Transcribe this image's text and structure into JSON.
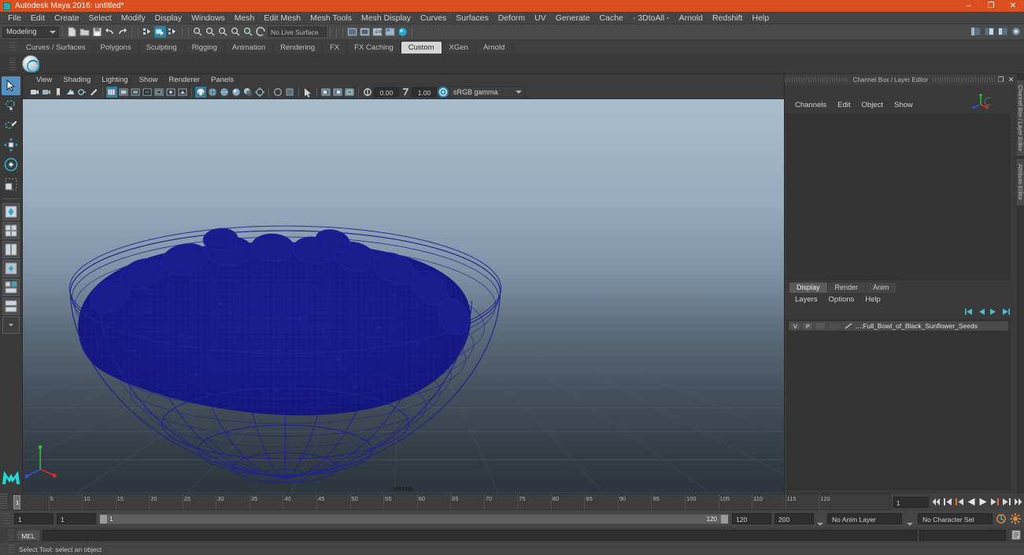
{
  "window": {
    "title": "Autodesk Maya 2016: untitled*",
    "app_icon": "maya-icon",
    "minimize": "–",
    "maximize": "❐",
    "close": "✕",
    "accent": "#d94f20"
  },
  "menubar": {
    "items": [
      "File",
      "Edit",
      "Create",
      "Select",
      "Modify",
      "Display",
      "Windows",
      "Mesh",
      "Edit Mesh",
      "Mesh Tools",
      "Mesh Display",
      "Curves",
      "Surfaces",
      "Deform",
      "UV",
      "Generate",
      "Cache",
      "- 3DtoAll -",
      "Arnold",
      "Redshift",
      "Help"
    ]
  },
  "statusline": {
    "menu_set": "Modeling",
    "live_surface": "No Live Surface",
    "icons": [
      "new-scene-icon",
      "open-scene-icon",
      "save-scene-icon",
      "undo-icon",
      "redo-icon",
      "select-by-hierarchy-icon",
      "select-by-object-icon",
      "select-by-component-icon",
      "snap-to-grid-icon",
      "snap-to-curve-icon",
      "snap-to-point-icon",
      "snap-to-projected-center-icon",
      "snap-to-view-plane-icon",
      "make-live-icon",
      "show-render-view-icon",
      "render-current-frame-icon",
      "ipr-render-icon",
      "render-settings-icon",
      "hypershade-icon"
    ],
    "right_icons": [
      "sidebar-toggle-icon",
      "channel-box-toggle-icon",
      "attribute-editor-toggle-icon",
      "tool-settings-toggle-icon"
    ]
  },
  "shelf": {
    "tabs": [
      "Curves / Surfaces",
      "Polygons",
      "Sculpting",
      "Rigging",
      "Animation",
      "Rendering",
      "FX",
      "FX Caching",
      "Custom",
      "XGen",
      "Arnold"
    ],
    "active_tab": "Custom",
    "buttons": [
      "custom-shelf-button"
    ]
  },
  "toolbox": {
    "tools": [
      {
        "name": "select-tool",
        "selected": true
      },
      {
        "name": "lasso-select-tool",
        "selected": false
      },
      {
        "name": "paint-select-tool",
        "selected": false
      },
      {
        "name": "move-tool",
        "selected": false
      },
      {
        "name": "rotate-tool",
        "selected": false
      },
      {
        "name": "scale-tool",
        "selected": false
      }
    ],
    "layouts": [
      "single-perspective-layout",
      "four-view-layout",
      "two-pane-side-layout",
      "outliner-persp-layout",
      "hypershade-persp-layout",
      "persp-graph-layout",
      "more-layouts"
    ],
    "logo": "maya-logo"
  },
  "viewport": {
    "panel_menu": [
      "View",
      "Shading",
      "Lighting",
      "Show",
      "Renderer",
      "Panels"
    ],
    "toolbar_icons": [
      "select-camera-icon",
      "camera-attributes-icon",
      "bookmark-icon",
      "image-plane-icon",
      "two-sided-lighting-icon",
      "grid-toggle-icon",
      "film-gate-icon",
      "resolution-gate-icon",
      "gate-mask-icon",
      "xray-icon",
      "xray-joints-icon",
      "xray-active-components-icon",
      "smooth-shade-all-icon",
      "wireframe-on-shaded-icon",
      "textured-icon",
      "use-all-lights-icon",
      "shadows-icon",
      "screen-space-ao-icon",
      "motion-blur-icon",
      "multisample-icon",
      "depth-of-field-icon",
      "isolate-select-icon",
      "grid-icon",
      "film-gate-2-icon",
      "exposure-icon",
      "gamma-icon",
      "color-management-icon"
    ],
    "exposure_value": "0.00",
    "gamma_value": "1.00",
    "view_transform": "sRGB gamma",
    "camera_label": "persp",
    "axis_gizmo": "axis-gizmo",
    "scene": {
      "object": "wireframe bowl filled with sunflower seeds",
      "wire_color": "#1b1f8f",
      "grid_color": "#5a6876"
    }
  },
  "channel_box": {
    "panel_title": "Channel Box / Layer Editor",
    "float_button": "❐",
    "close_button": "✕",
    "menu": [
      "Channels",
      "Edit",
      "Object",
      "Show"
    ],
    "axis_widget": "view-axis-widget"
  },
  "layer_editor": {
    "tabs": [
      "Display",
      "Render",
      "Anim"
    ],
    "active_tab": "Display",
    "menu": [
      "Layers",
      "Options",
      "Help"
    ],
    "toolbar_icons": [
      "layer-first-icon",
      "layer-prev-icon",
      "layer-next-icon",
      "layer-last-icon"
    ],
    "layers": [
      {
        "visible": "V",
        "playback": "P",
        "shading": "",
        "type_icon": "layer-line-icon",
        "name": "...:Full_Bowl_of_Black_Sunflower_Seeds"
      }
    ]
  },
  "vertical_tabs": [
    "Channel Box / Layer Editor",
    "Attribute Editor"
  ],
  "timeline": {
    "tick_labels": [
      "5",
      "10",
      "15",
      "20",
      "25",
      "30",
      "35",
      "40",
      "45",
      "50",
      "55",
      "60",
      "65",
      "70",
      "75",
      "80",
      "85",
      "90",
      "95",
      "100",
      "105",
      "110",
      "115",
      "120"
    ],
    "current_frame": "1",
    "current_frame_field": "1",
    "playback_buttons": [
      "go-to-start-icon",
      "step-back-key-icon",
      "step-back-frame-icon",
      "play-backwards-icon",
      "play-forwards-icon",
      "step-forward-frame-icon",
      "step-forward-key-icon",
      "go-to-end-icon"
    ]
  },
  "range_slider": {
    "start": "1",
    "anim_start": "1",
    "range_lo": "1",
    "range_hi": "120",
    "end": "120",
    "anim_end": "200",
    "anim_layer": "No Anim Layer",
    "character_set": "No Character Set",
    "right_icons": [
      "auto-key-icon",
      "animation-preferences-icon"
    ]
  },
  "command_line": {
    "language": "MEL",
    "input_value": "",
    "output_value": "",
    "script_editor_icon": "script-editor-icon"
  },
  "help_line": {
    "message": "Select Tool: select an object"
  }
}
